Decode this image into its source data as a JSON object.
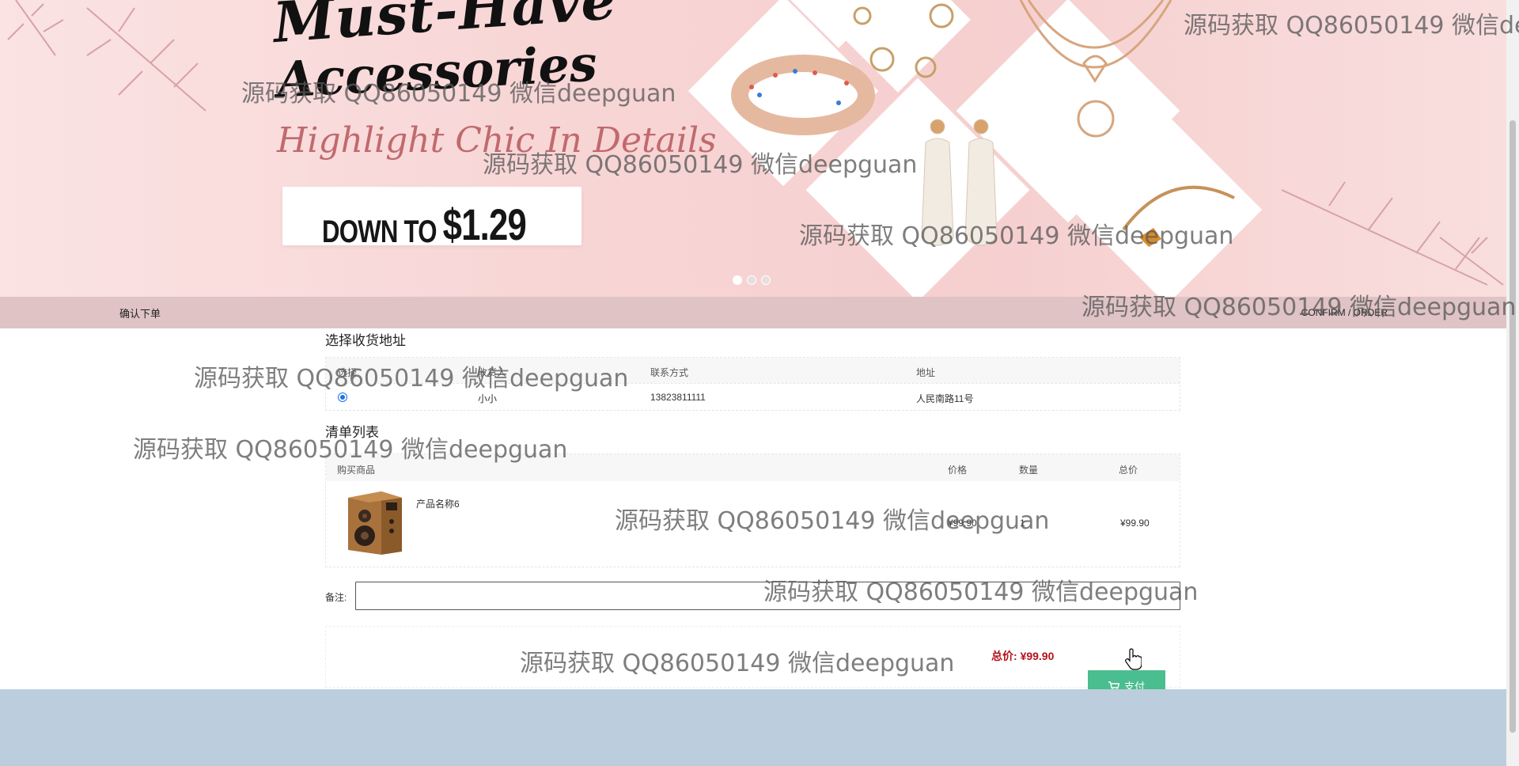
{
  "banner": {
    "headline_line1": "Must-Have",
    "headline_line2": "Accessories",
    "subheadline": "Highlight Chic In Details",
    "price_prefix": "DOWN TO",
    "price_value": "$1.29",
    "carousel_dots": 3,
    "active_dot": 1
  },
  "stepbar": {
    "title": "确认下单",
    "subtitle": "CONFIRM / ORDER"
  },
  "address": {
    "section_title": "选择收货地址",
    "headers": [
      "选择",
      "收货人",
      "联系方式",
      "地址"
    ],
    "rows": [
      {
        "name": "小小",
        "phone": "13823811111",
        "address": "人民南路11号",
        "selected": true
      }
    ]
  },
  "items": {
    "section_title": "清单列表",
    "headers": [
      "购买商品",
      "价格",
      "数量",
      "总价"
    ],
    "rows": [
      {
        "product": "产品名称6",
        "price": "¥99.90",
        "quantity": "1",
        "total": "¥99.90",
        "image_icon": "wooden-speaker"
      }
    ]
  },
  "remark": {
    "label": "备注:",
    "value": ""
  },
  "checkout": {
    "total_label": "总价: ",
    "total_value": "¥99.90",
    "submit_label": "支付",
    "accent_color": "#4bbe8f",
    "total_color": "#b5121b"
  },
  "watermark": "源码获取 QQ86050149 微信deepguan"
}
